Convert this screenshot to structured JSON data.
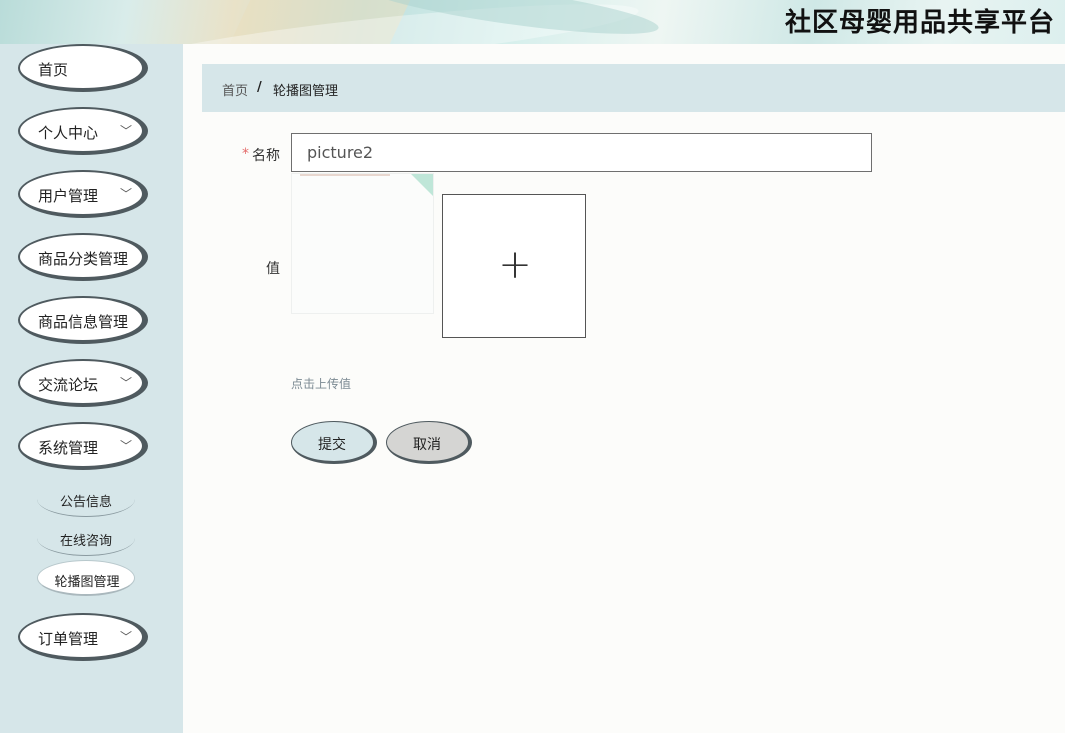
{
  "header": {
    "title": "社区母婴用品共享平台"
  },
  "sidebar": {
    "items": [
      {
        "label": "首页",
        "has_children": false
      },
      {
        "label": "个人中心",
        "has_children": true
      },
      {
        "label": "用户管理",
        "has_children": true
      },
      {
        "label": "商品分类管理",
        "has_children": false
      },
      {
        "label": "商品信息管理",
        "has_children": false
      },
      {
        "label": "交流论坛",
        "has_children": true
      },
      {
        "label": "系统管理",
        "has_children": true
      },
      {
        "label": "订单管理",
        "has_children": true
      }
    ],
    "system_children": [
      {
        "label": "公告信息"
      },
      {
        "label": "在线咨询"
      },
      {
        "label": "轮播图管理",
        "active": true
      }
    ],
    "chevron": "﹀"
  },
  "breadcrumb": {
    "home": "首页",
    "separator": "/",
    "current": "轮播图管理"
  },
  "form": {
    "required_mark": "*",
    "name_label": "名称",
    "name_value": "picture2",
    "value_label": "值",
    "upload_plus": "+",
    "upload_hint": "点击上传值",
    "submit_label": "提交",
    "cancel_label": "取消"
  },
  "colors": {
    "sidebar_bg": "#d6e6e9",
    "required": "#e46a6a",
    "cancel_bg": "#d5d5d3"
  }
}
